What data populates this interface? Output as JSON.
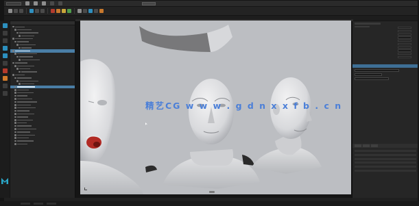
{
  "app": {
    "name": "Autodesk Maya",
    "logo_icon": "maya-logo-icon"
  },
  "watermark": {
    "text": "精艺CG  w w w . g d n x x f b . c n",
    "color": "#4b7fd8"
  },
  "menubar": {
    "menus": [
      "",
      "",
      "",
      "",
      "",
      "",
      "",
      "",
      ""
    ]
  },
  "shelf": {
    "icons": [
      "select-icon",
      "lasso-icon",
      "paint-icon",
      "move-icon",
      "rotate-icon",
      "scale-icon",
      "snap-grid-icon",
      "snap-curve-icon",
      "snap-point-icon",
      "render-icon",
      "ipr-icon",
      "render-settings-icon",
      "hypershade-icon",
      "light-icon",
      "camera-icon",
      "sculpt-icon"
    ]
  },
  "outliner": {
    "rows": 40,
    "selected_rows": [
      8,
      20
    ]
  },
  "viewport": {
    "background": "#bcbec2",
    "objects": [
      "head-hanging-mesh",
      "head-open-mouth",
      "head-front",
      "head-side"
    ]
  },
  "attribute_editor": {
    "highlight": "#3e6f95"
  },
  "colors": {
    "accent_blue": "#4a7ea6",
    "ui_dark": "#242424",
    "mouth_red": "#b12a24"
  }
}
